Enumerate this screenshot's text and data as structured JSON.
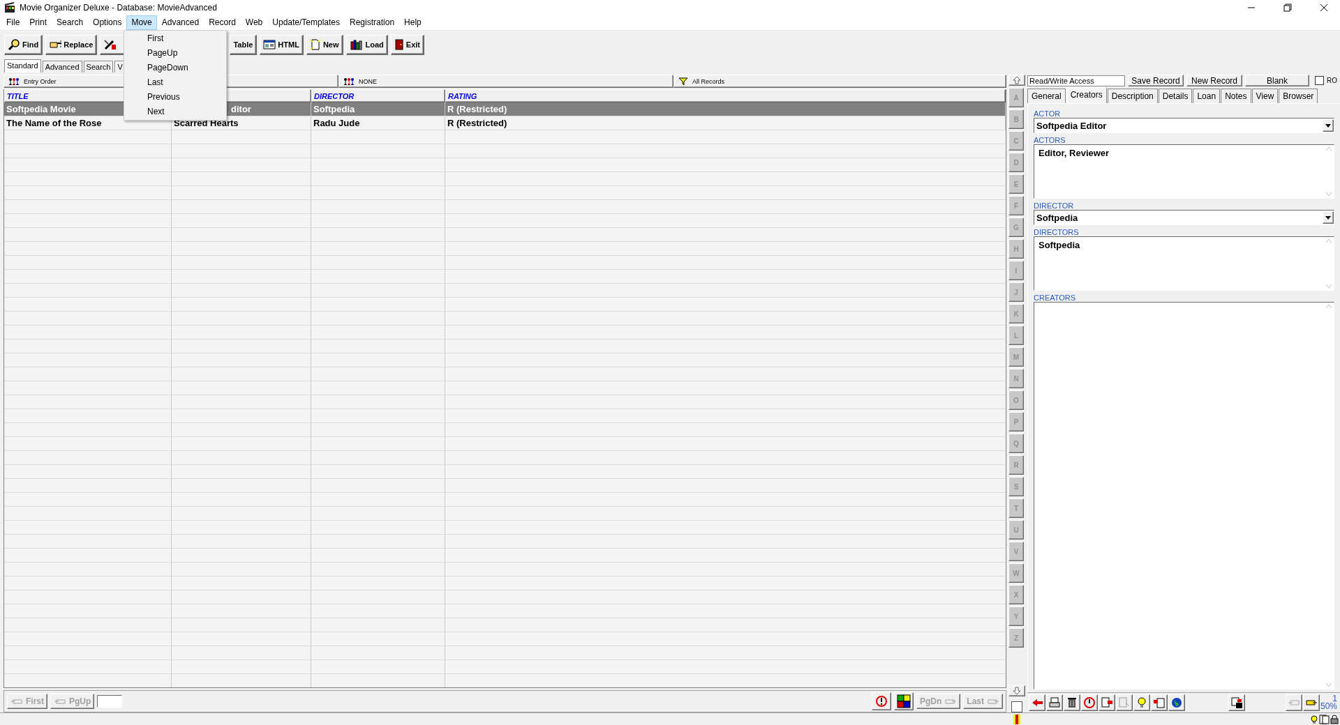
{
  "window": {
    "title": "Movie Organizer Deluxe - Database: MovieAdvanced"
  },
  "menu_bar": [
    {
      "label": "File",
      "selected": false
    },
    {
      "label": "Print",
      "selected": false
    },
    {
      "label": "Search",
      "selected": false
    },
    {
      "label": "Options",
      "selected": false
    },
    {
      "label": "Move",
      "selected": true
    },
    {
      "label": "Advanced",
      "selected": false
    },
    {
      "label": "Record",
      "selected": false
    },
    {
      "label": "Web",
      "selected": false
    },
    {
      "label": "Update/Templates",
      "selected": false
    },
    {
      "label": "Registration",
      "selected": false
    },
    {
      "label": "Help",
      "selected": false
    }
  ],
  "move_menu": [
    "First",
    "PageUp",
    "PageDown",
    "Last",
    "Previous",
    "Next"
  ],
  "toolbar": [
    {
      "kind": "find",
      "label": "Find"
    },
    {
      "kind": "replace",
      "label": "Replace"
    },
    {
      "kind": "tools"
    },
    {
      "kind": "table",
      "label": "Table"
    },
    {
      "kind": "html",
      "label": "HTML"
    },
    {
      "kind": "new",
      "label": "New"
    },
    {
      "kind": "load",
      "label": "Load"
    },
    {
      "kind": "exit",
      "label": "Exit"
    }
  ],
  "view_tabs": [
    {
      "label": "Standard",
      "selected": true
    },
    {
      "label": "Advanced",
      "selected": false
    },
    {
      "label": "Search",
      "selected": false
    },
    {
      "label": "V",
      "selected": false
    }
  ],
  "sort_bar": {
    "order": "Entry Order",
    "group": "NONE",
    "filter": "All Records"
  },
  "table": {
    "columns": {
      "title": "TITLE",
      "director": "DIRECTOR",
      "rating": "RATING"
    },
    "rows": [
      {
        "title": "Softpedia Movie",
        "column_2": "ditor",
        "director": "Softpedia",
        "rating": "R (Restricted)",
        "selected": true
      },
      {
        "title": "The Name of the Rose",
        "column_2": "Scarred Hearts",
        "director": "Radu Jude",
        "rating": "R (Restricted)",
        "selected": false
      }
    ]
  },
  "alpha_checkbox": {
    "checked": false
  },
  "alphabet": [
    "A",
    "B",
    "C",
    "D",
    "E",
    "F",
    "G",
    "H",
    "I",
    "J",
    "K",
    "L",
    "M",
    "N",
    "O",
    "P",
    "Q",
    "R",
    "S",
    "T",
    "U",
    "V",
    "W",
    "X",
    "Y",
    "Z"
  ],
  "detail": {
    "access": "Read/Write Access",
    "buttons": [
      "Save Record",
      "New Record",
      "Blank"
    ],
    "ro": {
      "label": "RO",
      "checked": false
    },
    "tabs": [
      {
        "label": "General",
        "selected": false
      },
      {
        "label": "Creators",
        "selected": true
      },
      {
        "label": "Description",
        "selected": false
      },
      {
        "label": "Details",
        "selected": false
      },
      {
        "label": "Loan",
        "selected": false
      },
      {
        "label": "Notes",
        "selected": false
      },
      {
        "label": "View",
        "selected": false
      },
      {
        "label": "Browser",
        "selected": false
      }
    ],
    "fields": [
      {
        "kind": "combo",
        "label": "ACTOR",
        "value": "Softpedia Editor"
      },
      {
        "kind": "memo",
        "label": "ACTORS",
        "value": "Editor, Reviewer"
      },
      {
        "kind": "combo",
        "label": "DIRECTOR",
        "value": "Softpedia"
      },
      {
        "kind": "memo",
        "label": "DIRECTORS",
        "value": "Softpedia"
      },
      {
        "kind": "memo",
        "label": "CREATORS"
      }
    ]
  },
  "nav_left": [
    {
      "label": "First",
      "disabled": true
    },
    {
      "label": "PgUp",
      "disabled": true
    }
  ],
  "nav_right": [
    {
      "label": "PgDn",
      "disabled": true
    },
    {
      "label": "Last",
      "disabled": true
    }
  ],
  "record_info": {
    "number": "1",
    "zoom": "50%"
  }
}
